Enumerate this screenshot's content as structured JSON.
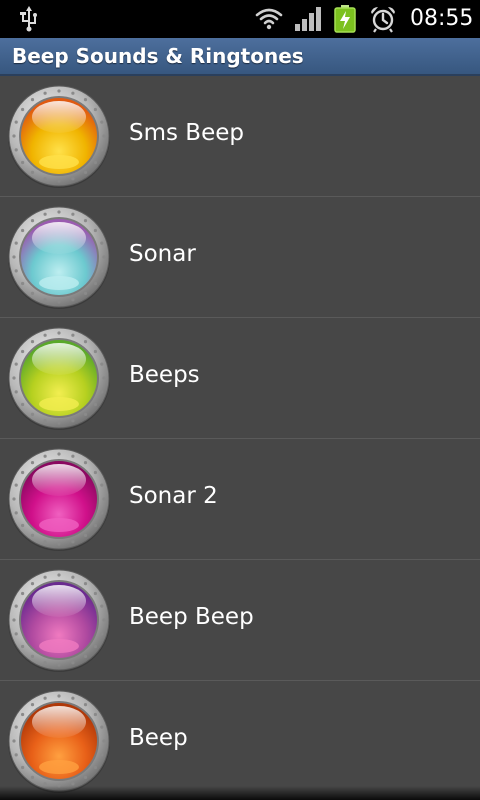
{
  "status_bar": {
    "time": "08:55",
    "icons": [
      "usb-icon",
      "wifi-icon",
      "signal-icon",
      "battery-charging-icon",
      "alarm-icon"
    ]
  },
  "title_bar": {
    "title": "Beep Sounds & Ringtones"
  },
  "sounds": [
    {
      "label": "Sms Beep",
      "color": "#f0b400",
      "inner": "#ffe14a",
      "edge": "#e05a10"
    },
    {
      "label": "Sonar",
      "color": "#6cc9cf",
      "inner": "#bdeef0",
      "edge": "#9a5bb0"
    },
    {
      "label": "Beeps",
      "color": "#b6d020",
      "inner": "#f2ee50",
      "edge": "#5aa82a"
    },
    {
      "label": "Sonar 2",
      "color": "#d0108a",
      "inner": "#f060c0",
      "edge": "#8a0860"
    },
    {
      "label": "Beep Beep",
      "color": "#b04aa0",
      "inner": "#f07ac0",
      "edge": "#6a2a90"
    },
    {
      "label": "Beep",
      "color": "#e86018",
      "inner": "#ffa040",
      "edge": "#b03808"
    }
  ]
}
